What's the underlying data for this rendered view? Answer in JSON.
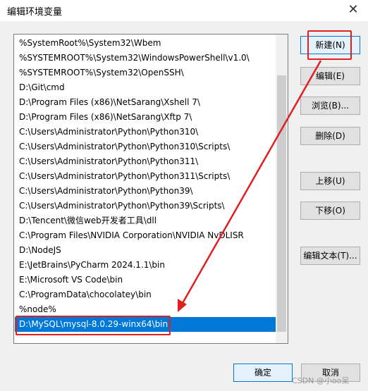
{
  "window": {
    "title": "编辑环境变量",
    "close_glyph": "✕"
  },
  "paths": [
    "%SystemRoot%\\System32\\Wbem",
    "%SYSTEMROOT%\\System32\\WindowsPowerShell\\v1.0\\",
    "%SYSTEMROOT%\\System32\\OpenSSH\\",
    "D:\\Git\\cmd",
    "D:\\Program Files (x86)\\NetSarang\\Xshell 7\\",
    "D:\\Program Files (x86)\\NetSarang\\Xftp 7\\",
    "C:\\Users\\Administrator\\Python\\Python310\\",
    "C:\\Users\\Administrator\\Python\\Python310\\Scripts\\",
    "C:\\Users\\Administrator\\Python\\Python311\\",
    "C:\\Users\\Administrator\\Python\\Python311\\Scripts\\",
    "C:\\Users\\Administrator\\Python\\Python39\\",
    "C:\\Users\\Administrator\\Python\\Python39\\Scripts\\",
    "D:\\Tencent\\微信web开发者工具\\dll",
    "C:\\Program Files\\NVIDIA Corporation\\NVIDIA NvDLISR",
    "D:\\NodeJS",
    "E:\\JetBrains\\PyCharm 2024.1.1\\bin",
    "E:\\Microsoft VS Code\\bin",
    "C:\\ProgramData\\chocolatey\\bin",
    "%node%",
    "D:\\MySQL\\mysql-8.0.29-winx64\\bin"
  ],
  "selected_index": 19,
  "buttons": {
    "new": "新建(N)",
    "edit": "编辑(E)",
    "browse": "浏览(B)...",
    "delete": "删除(D)",
    "move_up": "上移(U)",
    "move_down": "下移(O)",
    "edit_text": "编辑文本(T)...",
    "ok": "确定",
    "cancel": "取消"
  },
  "watermark": "CSDN @小oo呆",
  "colors": {
    "selection": "#0078d7",
    "annotation": "#e02020"
  }
}
